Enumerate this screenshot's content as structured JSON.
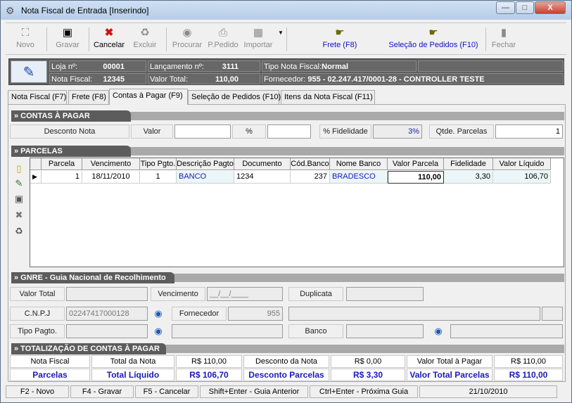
{
  "window": {
    "title": "Nota Fiscal de Entrada [Inserindo]",
    "min": "—",
    "max": "□",
    "close": "X"
  },
  "toolbar": {
    "novo": "Novo",
    "gravar": "Gravar",
    "cancelar": "Cancelar",
    "excluir": "Excluir",
    "procurar": "Procurar",
    "ppedido": "P.Pedido",
    "importar": "Importar",
    "frete": "Frete (F8)",
    "selecao": "Seleção de Pedidos (F10)",
    "fechar": "Fechar"
  },
  "info": {
    "loja_label": "Loja nº:",
    "loja": "00001",
    "lanc_label": "Lançamento nº:",
    "lanc": "3111",
    "tipo_label": "Tipo Nota Fiscal:",
    "tipo": "Normal",
    "nf_label": "Nota Fiscal:",
    "nf": "12345",
    "vt_label": "Valor Total:",
    "vt": "110,00",
    "forn_label": "Fornecedor:",
    "forn": "955 - 02.247.417/0001-28 - CONTROLLER TESTE"
  },
  "tabs": [
    "Nota Fiscal (F7)",
    "Frete (F8)",
    "Contas à Pagar (F9)",
    "Seleção de Pedidos (F10)",
    "Itens da Nota Fiscal (F11)"
  ],
  "sections": {
    "contas": "» CONTAS À PAGAR",
    "parcelas": "» PARCELAS",
    "gnre": "» GNRE - Guia Nacional de Recolhimento",
    "totalizacao": "» TOTALIZAÇÃO DE CONTAS À PAGAR"
  },
  "desconto": {
    "label": "Desconto Nota",
    "valor_label": "Valor",
    "pct_label": "%",
    "fid_label": "% Fidelidade",
    "fid": "3%",
    "qtde_label": "Qtde. Parcelas",
    "qtde": "1"
  },
  "grid": {
    "headers": [
      "Parcela",
      "Vencimento",
      "Tipo Pgto.",
      "Descrição Pagto",
      "Documento",
      "Cód.Banco",
      "Nome Banco",
      "Valor Parcela",
      "Fidelidade",
      "Valor Líquido"
    ],
    "row": [
      "1",
      "18/11/2010",
      "1",
      "BANCO",
      "1234",
      "237",
      "BRADESCO",
      "110,00",
      "3,30",
      "106,70"
    ]
  },
  "gnre": {
    "valor_total": "Valor Total",
    "vencimento": "Vencimento",
    "venc_val": "__/__/____",
    "duplicata": "Duplicata",
    "cnpj": "C.N.P.J",
    "cnpj_val": "02247417000128",
    "fornecedor": "Fornecedor",
    "forn_val": "955",
    "tipo_pgto": "Tipo Pagto.",
    "banco": "Banco"
  },
  "totais": {
    "nota_fiscal": "Nota Fiscal",
    "total_nota": "Total da Nota",
    "total_nota_val": "R$ 110,00",
    "desc_nota": "Desconto da Nota",
    "desc_nota_val": "R$ 0,00",
    "vt_pagar": "Valor Total à Pagar",
    "vt_pagar_val": "R$ 110,00",
    "parcelas": "Parcelas",
    "total_liq": "Total Líquido",
    "total_liq_val": "R$ 106,70",
    "desc_parc": "Desconto Parcelas",
    "desc_parc_val": "R$ 3,30",
    "vt_parc": "Valor Total Parcelas",
    "vt_parc_val": "R$ 110,00"
  },
  "status": [
    "F2 - Novo",
    "F4 - Gravar",
    "F5 - Cancelar",
    "Shift+Enter - Guia Anterior",
    "Ctrl+Enter - Próxima Guia",
    "21/10/2010"
  ]
}
